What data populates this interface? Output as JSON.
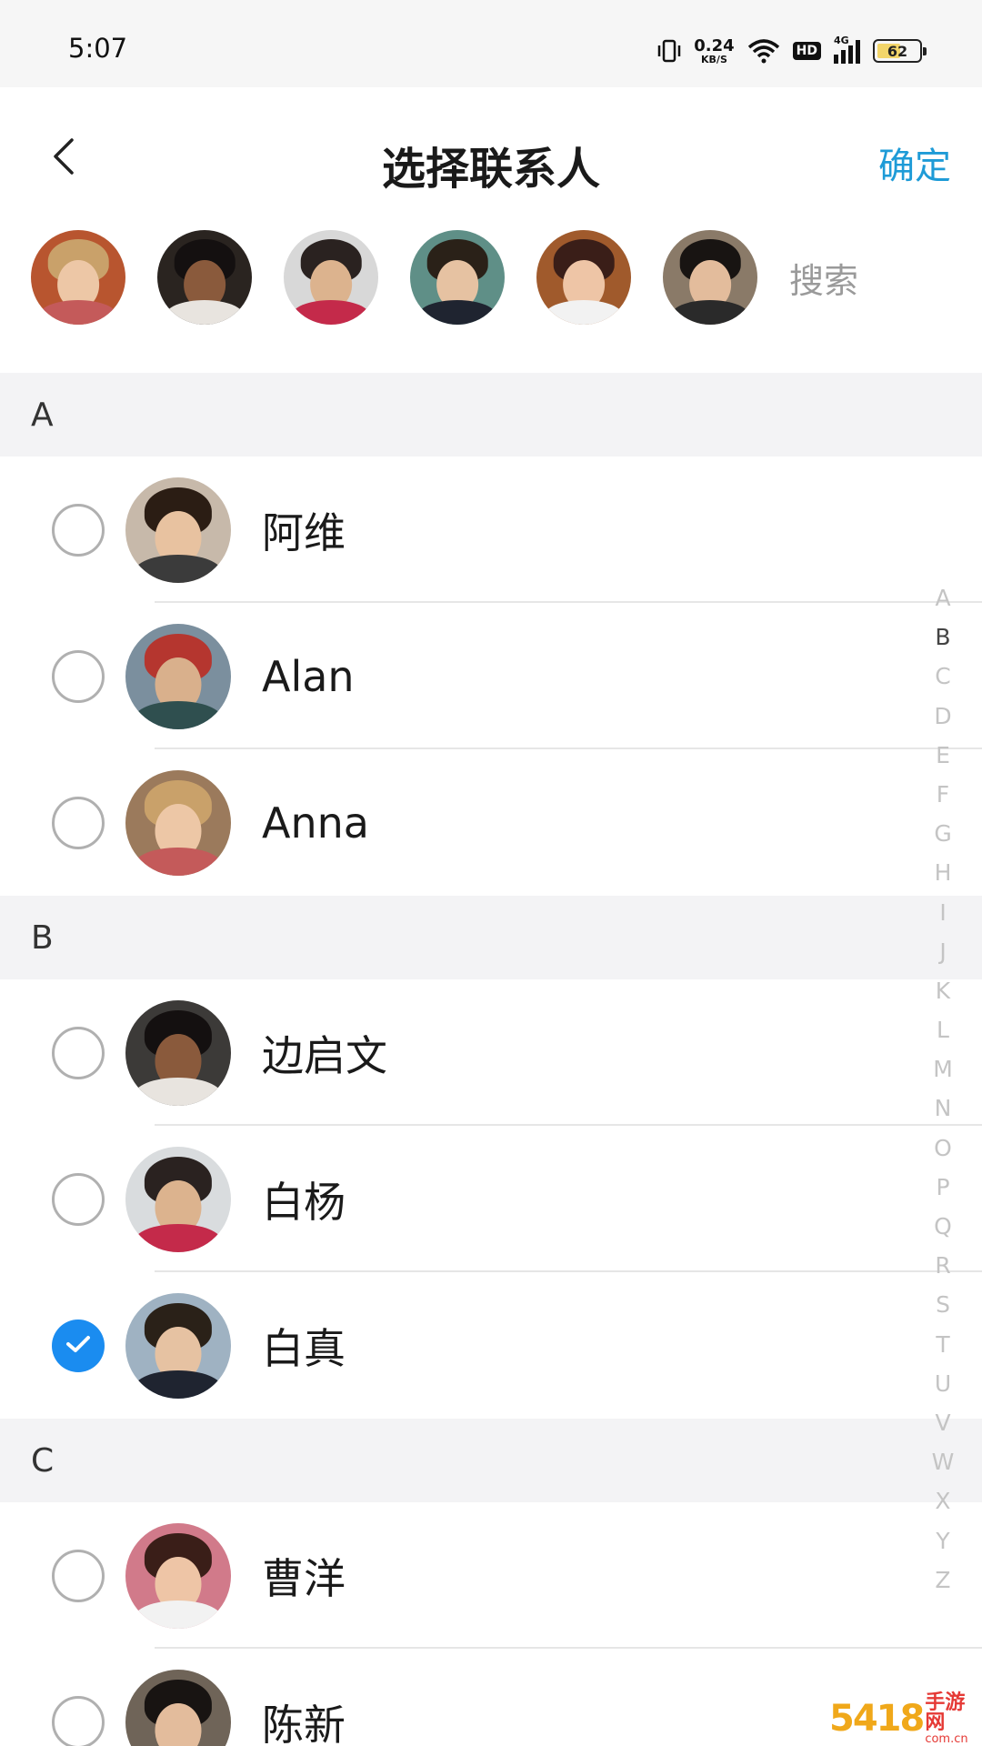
{
  "status_bar": {
    "time": "5:07",
    "net_speed_value": "0.24",
    "net_speed_unit": "KB/S",
    "hd_label": "HD",
    "network_label": "4G",
    "battery_level": "62"
  },
  "header": {
    "title": "选择联系人",
    "confirm_label": "确定"
  },
  "selected_strip": {
    "avatars": [
      {
        "icon": "selected-contact-avatar-1",
        "bg": "#b8552f"
      },
      {
        "icon": "selected-contact-avatar-2",
        "bg": "#2a2420"
      },
      {
        "icon": "selected-contact-avatar-3",
        "bg": "#d8d8d8"
      },
      {
        "icon": "selected-contact-avatar-4",
        "bg": "#5f8f87"
      },
      {
        "icon": "selected-contact-avatar-5",
        "bg": "#a05a2c"
      },
      {
        "icon": "selected-contact-avatar-6",
        "bg": "#8a7a68"
      }
    ],
    "search_label": "搜索"
  },
  "sections": [
    {
      "letter": "A",
      "contacts": [
        {
          "name": "阿维",
          "checked": false
        },
        {
          "name": "Alan",
          "checked": false
        },
        {
          "name": "Anna",
          "checked": false
        }
      ]
    },
    {
      "letter": "B",
      "contacts": [
        {
          "name": "边启文",
          "checked": false
        },
        {
          "name": "白杨",
          "checked": false
        },
        {
          "name": "白真",
          "checked": true
        }
      ]
    },
    {
      "letter": "C",
      "contacts": [
        {
          "name": "曹洋",
          "checked": false
        },
        {
          "name": "陈新",
          "checked": false
        }
      ]
    }
  ],
  "alpha_index": {
    "letters": [
      "A",
      "B",
      "C",
      "D",
      "E",
      "F",
      "G",
      "H",
      "I",
      "J",
      "K",
      "L",
      "M",
      "N",
      "O",
      "P",
      "Q",
      "R",
      "S",
      "T",
      "U",
      "V",
      "W",
      "X",
      "Y",
      "Z"
    ],
    "active": "B"
  },
  "watermark": {
    "number": "5418",
    "text": "手游网",
    "domain": "com.cn"
  },
  "colors": {
    "accent": "#1e9bd7",
    "checkbox_checked": "#1a8cf0",
    "section_bg": "#f3f3f5"
  }
}
